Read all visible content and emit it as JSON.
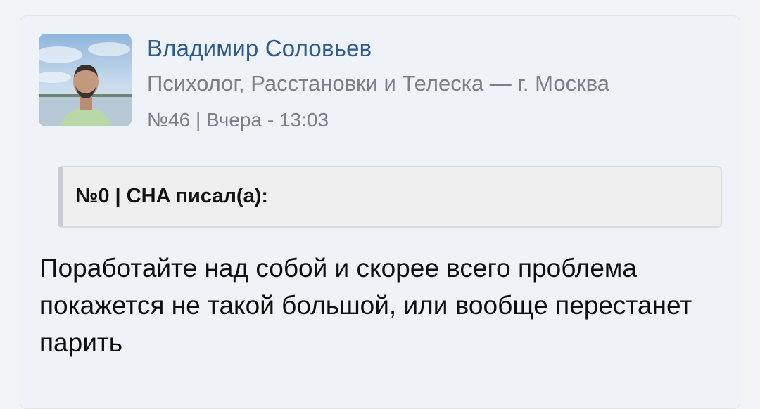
{
  "post": {
    "author": {
      "name": "Владимир Соловьев",
      "description": "Психолог, Расстановки и Телеска — г. Москва"
    },
    "meta": "№46 | Вчера - 13:03",
    "quote": {
      "header": "№0 | CHA писал(а):"
    },
    "body": "Поработайте над собой и скорее всего проблема покажется не такой большой, или вообще перестанет парить"
  },
  "colors": {
    "author_name": "#2f5c8f",
    "secondary_text": "#7b8088",
    "card_background": "#eff2f6",
    "quote_background": "#efefef",
    "quote_border": "#c8cbd1"
  }
}
